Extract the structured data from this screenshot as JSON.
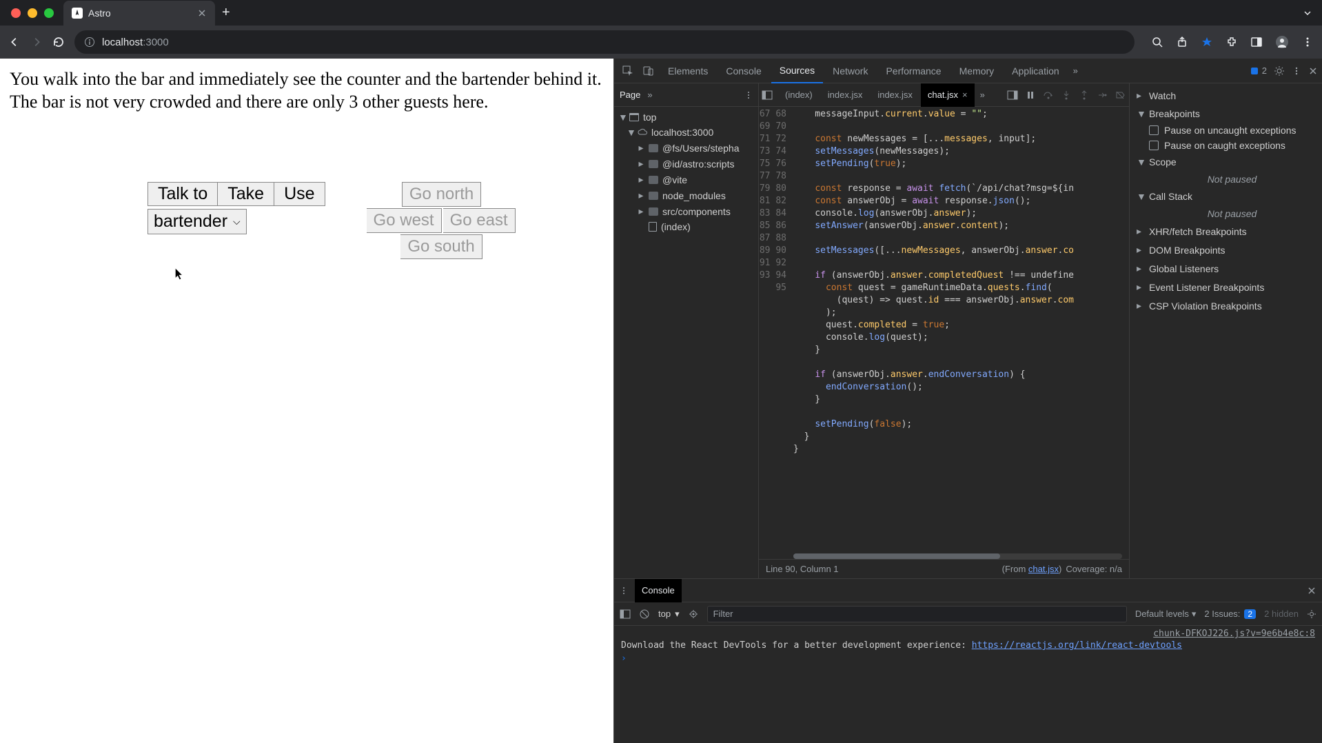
{
  "browser": {
    "tab_title": "Astro",
    "url_host": "localhost",
    "url_port": ":3000"
  },
  "page": {
    "narrative": "You walk into the bar and immediately see the counter and the bartender behind it. The bar is not very crowded and there are only 3 other guests here.",
    "actions": {
      "talk": "Talk to",
      "take": "Take",
      "use": "Use"
    },
    "selected_target": "bartender",
    "dirs": {
      "n": "Go north",
      "s": "Go south",
      "e": "Go east",
      "w": "Go west"
    }
  },
  "devtools": {
    "main_tabs": [
      "Elements",
      "Console",
      "Sources",
      "Network",
      "Performance",
      "Memory",
      "Application"
    ],
    "active_main_tab": "Sources",
    "issues_count": "2",
    "left_head": "Page",
    "tree": {
      "top": "top",
      "host": "localhost:3000",
      "folders": [
        "@fs/Users/stepha",
        "@id/astro:scripts",
        "@vite",
        "node_modules",
        "src/components"
      ],
      "file": "(index)"
    },
    "file_tabs": [
      "(index)",
      "index.jsx",
      "index.jsx",
      "chat.jsx"
    ],
    "active_file_tab": "chat.jsx",
    "line_start": 67,
    "code_lines": [
      "    messageInput.current.value = \"\";",
      "",
      "    const newMessages = [...messages, input];",
      "    setMessages(newMessages);",
      "    setPending(true);",
      "",
      "    const response = await fetch(`/api/chat?msg=${in",
      "    const answerObj = await response.json();",
      "    console.log(answerObj.answer);",
      "    setAnswer(answerObj.answer.content);",
      "",
      "    setMessages([...newMessages, answerObj.answer.co",
      "",
      "    if (answerObj.answer.completedQuest !== undefine",
      "      const quest = gameRuntimeData.quests.find(",
      "        (quest) => quest.id === answerObj.answer.com",
      "      );",
      "      quest.completed = true;",
      "      console.log(quest);",
      "    }",
      "",
      "    if (answerObj.answer.endConversation) {",
      "      endConversation();",
      "    }",
      "",
      "    setPending(false);",
      "  }",
      "}",
      ""
    ],
    "status": {
      "pos": "Line 90, Column 1",
      "from_label": "(From ",
      "from_link": "chat.jsx",
      "from_close": ")",
      "coverage": "Coverage: n/a"
    },
    "right_pane": {
      "sections": [
        "Watch",
        "Breakpoints",
        "Scope",
        "Call Stack",
        "XHR/fetch Breakpoints",
        "DOM Breakpoints",
        "Global Listeners",
        "Event Listener Breakpoints",
        "CSP Violation Breakpoints"
      ],
      "bp_uncaught": "Pause on uncaught exceptions",
      "bp_caught": "Pause on caught exceptions",
      "not_paused": "Not paused"
    },
    "console": {
      "tab": "Console",
      "top_scope": "top",
      "filter_placeholder": "Filter",
      "levels": "Default levels",
      "issues_label": "2 Issues:",
      "issues_badge": "2",
      "hidden": "2 hidden",
      "src": "chunk-DFKOJ226.js?v=9e6b4e8c:8",
      "msg_prefix": "Download the React DevTools for a better development experience: ",
      "msg_link": "https://reactjs.org/link/react-devtools"
    }
  }
}
